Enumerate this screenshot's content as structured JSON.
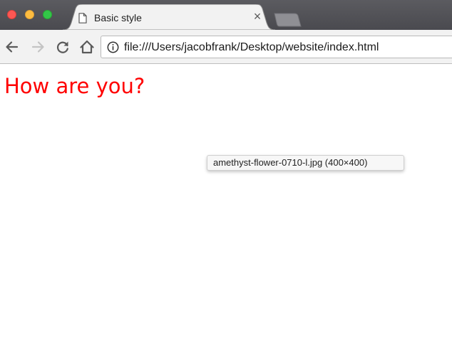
{
  "window": {
    "controls": [
      "close",
      "minimize",
      "maximize"
    ]
  },
  "tab": {
    "title": "Basic style",
    "close_glyph": "×",
    "icon": "page-icon"
  },
  "toolbar": {
    "back_icon": "back-arrow-icon",
    "forward_icon": "forward-arrow-icon",
    "reload_icon": "reload-icon",
    "home_icon": "home-icon",
    "info_icon": "info-icon",
    "url": "file:///Users/jacobfrank/Desktop/website/index.html"
  },
  "page": {
    "heading": "How are you?",
    "heading_color": "#ff0000",
    "tooltip": "amethyst-flower-0710-l.jpg (400×400)"
  }
}
